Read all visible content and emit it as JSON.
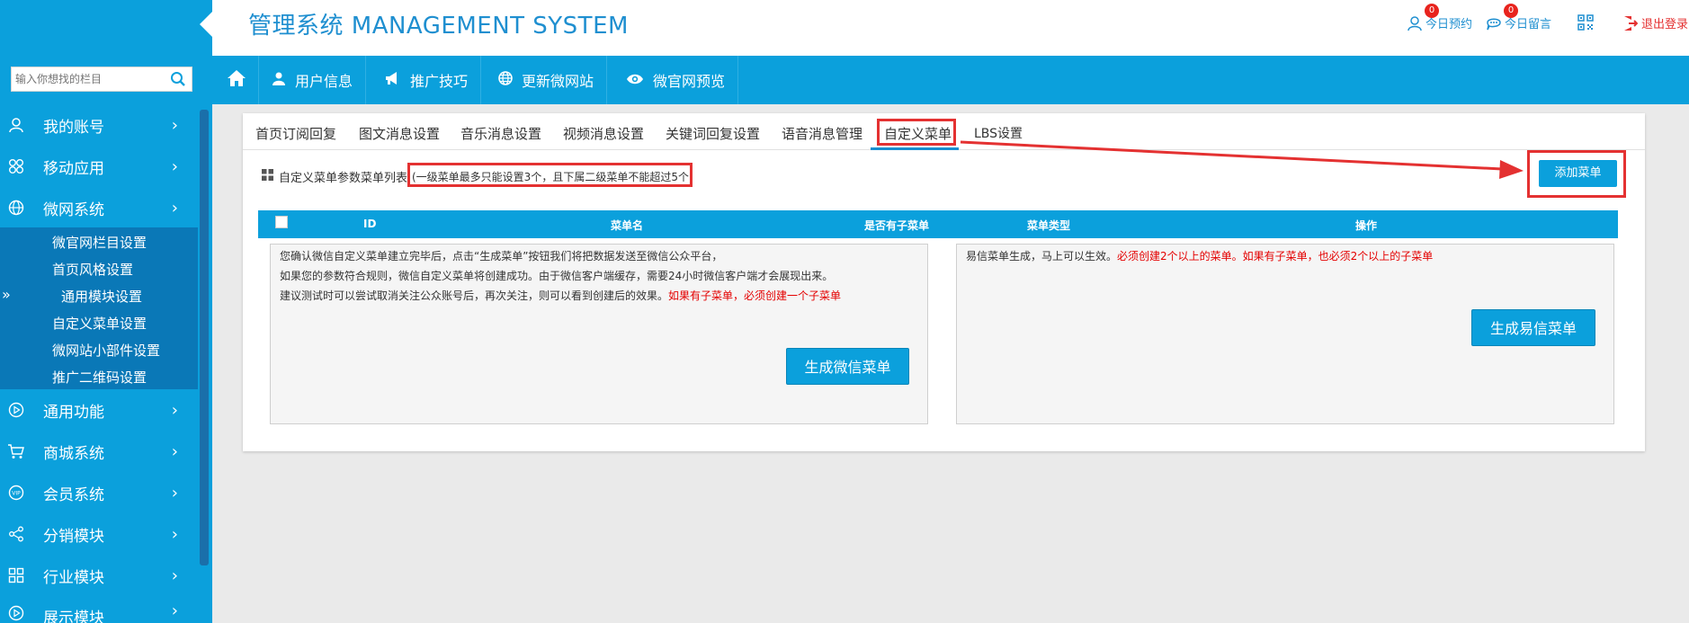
{
  "header": {
    "title": "管理系统 MANAGEMENT SYSTEM",
    "appointments": {
      "label": "今日预约",
      "count": "0"
    },
    "messages": {
      "label": "今日留言",
      "count": "0"
    },
    "logout": "退出登录"
  },
  "search": {
    "placeholder": "输入你想找的栏目"
  },
  "topnav": [
    {
      "label": "用户信息",
      "icon": "user-icon"
    },
    {
      "label": "推广技巧",
      "icon": "megaphone-icon"
    },
    {
      "label": "更新微网站",
      "icon": "globe-icon"
    },
    {
      "label": "微官网预览",
      "icon": "eye-icon"
    }
  ],
  "sidebar": {
    "items": [
      {
        "label": "我的账号",
        "icon": "user-icon"
      },
      {
        "label": "移动应用",
        "icon": "apps-icon"
      },
      {
        "label": "微网系统",
        "icon": "globe-icon"
      },
      {
        "label": "通用功能",
        "icon": "play-circle-icon"
      },
      {
        "label": "商城系统",
        "icon": "cart-icon"
      },
      {
        "label": "会员系统",
        "icon": "vip-icon"
      },
      {
        "label": "分销模块",
        "icon": "share-icon"
      },
      {
        "label": "行业模块",
        "icon": "grid-icon"
      },
      {
        "label": "展示模块",
        "icon": "play-circle-icon"
      }
    ],
    "submenu": [
      "微官网栏目设置",
      "首页风格设置",
      "通用模块设置",
      "自定义菜单设置",
      "微网站小部件设置",
      "推广二维码设置"
    ]
  },
  "tabs": [
    "首页订阅回复",
    "图文消息设置",
    "音乐消息设置",
    "视频消息设置",
    "关键词回复设置",
    "语音消息管理",
    "自定义菜单",
    "LBS设置"
  ],
  "active_tab": "自定义菜单",
  "list": {
    "title": "自定义菜单参数菜单列表",
    "note": "(一级菜单最多只能设置3个，且下属二级菜单不能超过5个)",
    "add_button": "添加菜单"
  },
  "table": {
    "columns": [
      "ID",
      "菜单名",
      "是否有子菜单",
      "菜单类型",
      "操作"
    ]
  },
  "wechat_box": {
    "line1": "您确认微信自定义菜单建立完毕后，点击“生成菜单”按钮我们将把数据发送至微信公众平台，",
    "line2": "如果您的参数符合规则，微信自定义菜单将创建成功。由于微信客户端缓存，需要24小时微信客户端才会展现出来。",
    "line3": "建议测试时可以尝试取消关注公众账号后，再次关注，则可以看到创建后的效果。",
    "line3_red": "如果有子菜单，必须创建一个子菜单",
    "button": "生成微信菜单"
  },
  "yixin_box": {
    "line1": "易信菜单生成，马上可以生效。",
    "line1_red": "必须创建2个以上的菜单。如果有子菜单，也必须2个以上的子菜单",
    "button": "生成易信菜单"
  },
  "colors": {
    "primary": "#0ba0dc",
    "submenu": "#0a78b7",
    "highlight": "#e43131"
  }
}
